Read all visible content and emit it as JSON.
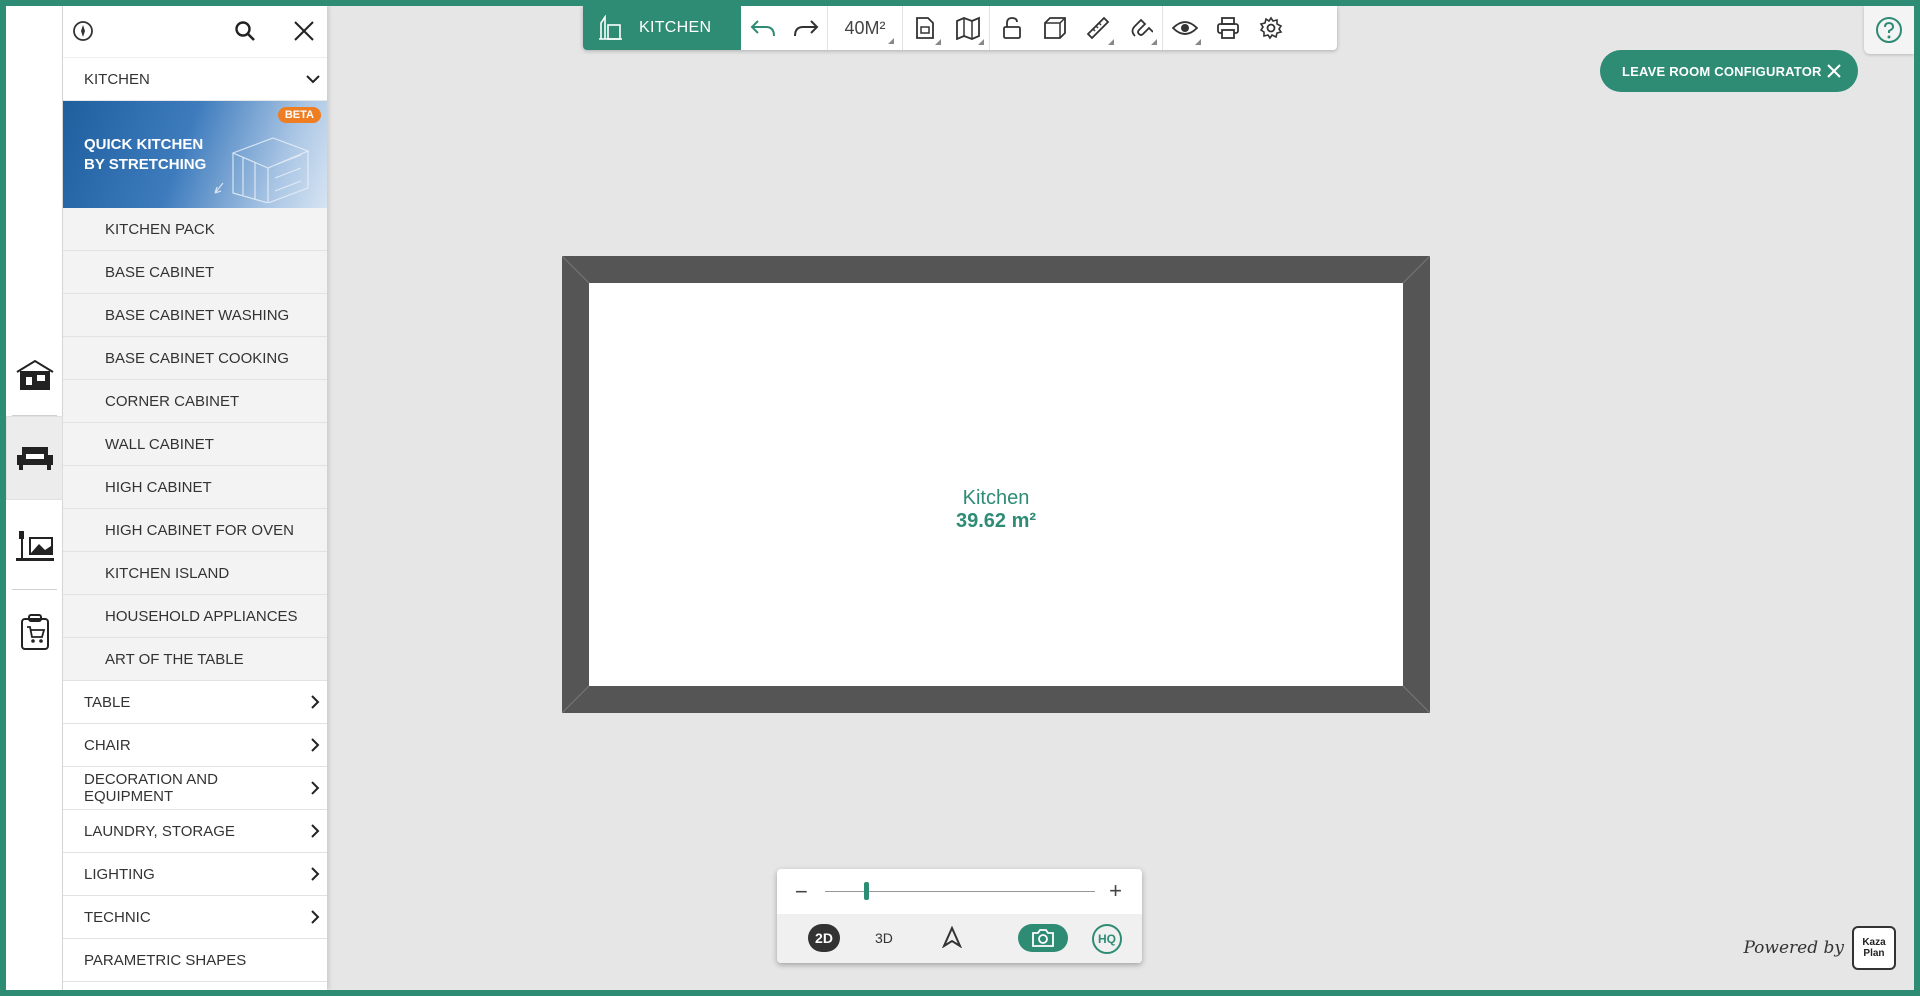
{
  "panel": {
    "category": "KITCHEN",
    "banner": {
      "title": "QUICK KITCHEN BY STRETCHING",
      "badge": "BETA"
    },
    "sub_items": [
      "KITCHEN PACK",
      "BASE CABINET",
      "BASE CABINET WASHING",
      "BASE CABINET COOKING",
      "CORNER CABINET",
      "WALL CABINET",
      "HIGH CABINET",
      "HIGH CABINET FOR OVEN",
      "KITCHEN ISLAND",
      "HOUSEHOLD APPLIANCES",
      "ART OF THE TABLE"
    ],
    "categories": [
      "TABLE",
      "CHAIR",
      "DECORATION AND EQUIPMENT",
      "LAUNDRY, STORAGE",
      "LIGHTING",
      "TECHNIC"
    ],
    "last_item": "PARAMETRIC SHAPES"
  },
  "toolbar": {
    "room_label": "KITCHEN",
    "area": "40M²"
  },
  "leave_button": "LEAVE ROOM CONFIGURATOR",
  "room": {
    "name": "Kitchen",
    "area": "39.62 m²"
  },
  "view": {
    "zoom_level": 0.15,
    "mode_2d": "2D",
    "mode_3d": "3D",
    "hq": "HQ"
  },
  "footer": {
    "powered": "Powered by",
    "brand_line1": "Kaza",
    "brand_line2": "Plan"
  },
  "colors": {
    "accent": "#2e8b74",
    "wall": "#555555",
    "beta": "#ef7d22"
  }
}
